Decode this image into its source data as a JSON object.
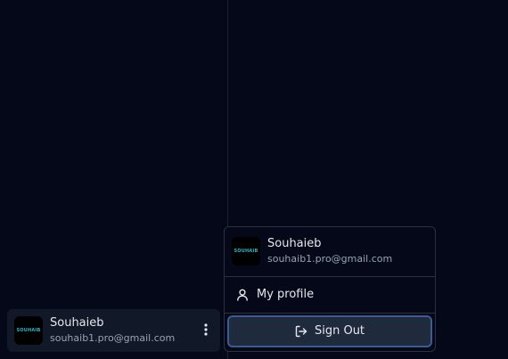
{
  "user": {
    "name": "Souhaieb",
    "email": "souhaib1.pro@gmail.com",
    "avatar_text": "SOUHAIB"
  },
  "menu": {
    "profile_label": "My profile",
    "signout_label": "Sign Out"
  },
  "icons": {
    "more": "more-vertical-icon",
    "profile": "user-icon",
    "signout": "log-out-icon"
  },
  "colors": {
    "background": "#040818",
    "card": "#111827",
    "border": "#2a3142",
    "accent_border": "#3b5b92",
    "button": "#1f2a3d",
    "text": "#e6e8ee",
    "muted_text": "#9aa3b4",
    "logo": "#2bb5c7"
  }
}
